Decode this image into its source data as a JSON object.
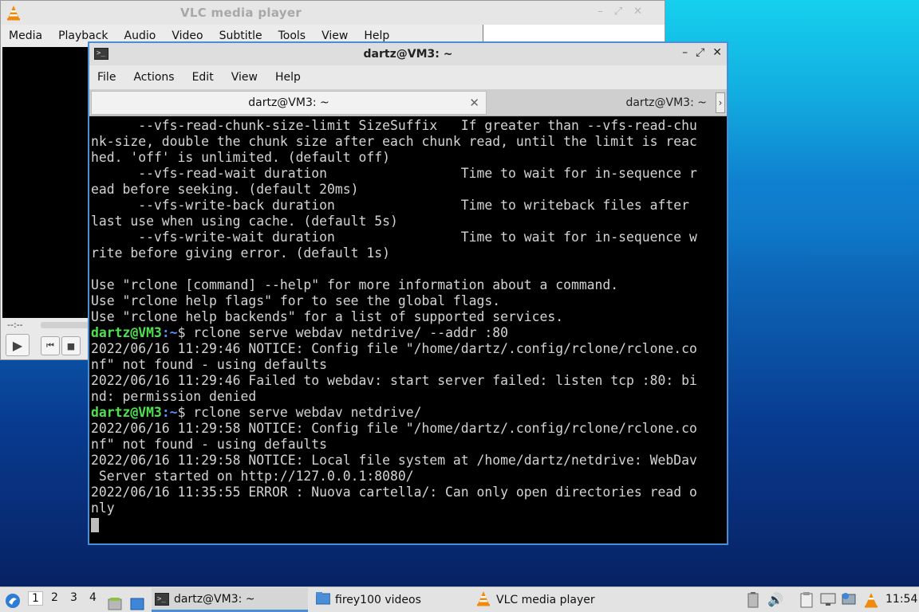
{
  "vlc": {
    "title": "VLC media player",
    "menu": [
      "Media",
      "Playback",
      "Audio",
      "Video",
      "Subtitle",
      "Tools",
      "View",
      "Help"
    ],
    "time": "--:--"
  },
  "terminal": {
    "title": "dartz@VM3: ~",
    "menu": [
      "File",
      "Actions",
      "Edit",
      "View",
      "Help"
    ],
    "tabs": [
      {
        "label": "dartz@VM3: ~",
        "active": true
      },
      {
        "label": "dartz@VM3: ~",
        "active": false
      }
    ],
    "lines": [
      {
        "text": "      --vfs-read-chunk-size-limit SizeSuffix   If greater than --vfs-read-chu"
      },
      {
        "text": "nk-size, double the chunk size after each chunk read, until the limit is reac"
      },
      {
        "text": "hed. 'off' is unlimited. (default off)"
      },
      {
        "text": "      --vfs-read-wait duration                 Time to wait for in-sequence r"
      },
      {
        "text": "ead before seeking. (default 20ms)"
      },
      {
        "text": "      --vfs-write-back duration                Time to writeback files after"
      },
      {
        "text": "last use when using cache. (default 5s)"
      },
      {
        "text": "      --vfs-write-wait duration                Time to wait for in-sequence w"
      },
      {
        "text": "rite before giving error. (default 1s)"
      },
      {
        "text": ""
      },
      {
        "text": "Use \"rclone [command] --help\" for more information about a command."
      },
      {
        "text": "Use \"rclone help flags\" for to see the global flags."
      },
      {
        "text": "Use \"rclone help backends\" for a list of supported services."
      },
      {
        "prompt_user": "dartz@VM3",
        "prompt_path": ":~",
        "text": "$ rclone serve webdav netdrive/ --addr :80"
      },
      {
        "text": "2022/06/16 11:29:46 NOTICE: Config file \"/home/dartz/.config/rclone/rclone.co"
      },
      {
        "text": "nf\" not found - using defaults"
      },
      {
        "text": "2022/06/16 11:29:46 Failed to webdav: start server failed: listen tcp :80: bi"
      },
      {
        "text": "nd: permission denied"
      },
      {
        "prompt_user": "dartz@VM3",
        "prompt_path": ":~",
        "text": "$ rclone serve webdav netdrive/"
      },
      {
        "text": "2022/06/16 11:29:58 NOTICE: Config file \"/home/dartz/.config/rclone/rclone.co"
      },
      {
        "text": "nf\" not found - using defaults"
      },
      {
        "text": "2022/06/16 11:29:58 NOTICE: Local file system at /home/dartz/netdrive: WebDav"
      },
      {
        "text": " Server started on http://127.0.0.1:8080/"
      },
      {
        "text": "2022/06/16 11:35:55 ERROR : Nuova cartella/: Can only open directories read o"
      },
      {
        "text": "nly"
      }
    ]
  },
  "taskbar": {
    "workspaces": [
      "1",
      "2",
      "3",
      "4"
    ],
    "tasks": [
      {
        "label": "dartz@VM3: ~",
        "icon": "terminal-icon",
        "active": true
      },
      {
        "label": "firey100 videos",
        "icon": "folder-icon",
        "active": false
      },
      {
        "label": "VLC media player",
        "icon": "vlc-cone-icon",
        "active": false
      }
    ],
    "clock": "11:54"
  },
  "colors": {
    "prompt_user": "#4ee24e",
    "prompt_path": "#5b8cff",
    "terminal_bg": "#000000",
    "focus_border": "#4a8fd6"
  }
}
